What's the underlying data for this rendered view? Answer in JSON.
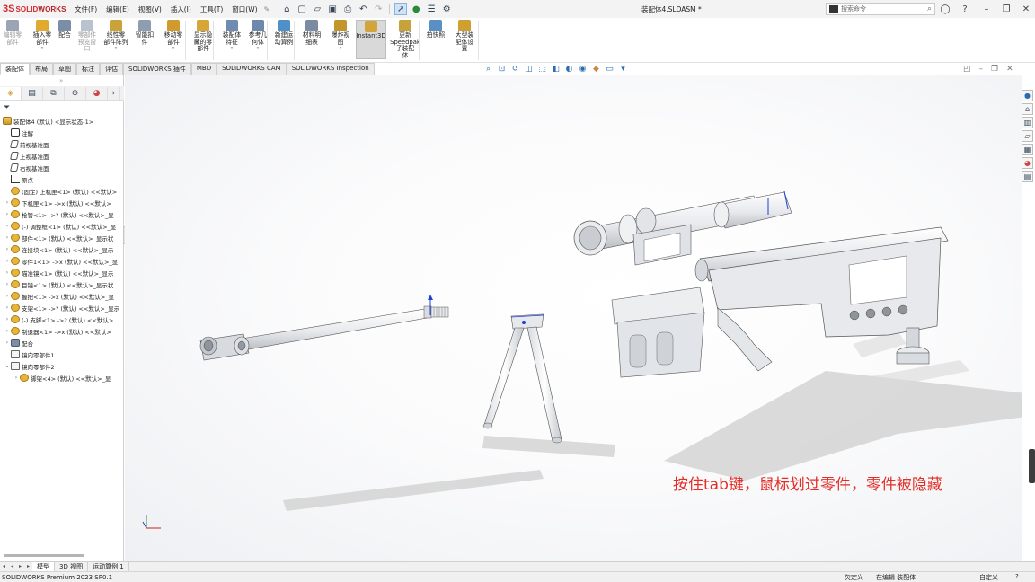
{
  "app": {
    "logo_mark": "3S",
    "logo_word_a": "SOLID",
    "logo_word_b": "WORKS",
    "document_title": "装配体4.SLDASM *",
    "search_placeholder": "搜索命令"
  },
  "menu": [
    "文件(F)",
    "编辑(E)",
    "视图(V)",
    "插入(I)",
    "工具(T)",
    "窗口(W)"
  ],
  "ribbon": {
    "buttons": [
      {
        "label": "编辑零\n部件",
        "disabled": true,
        "color": "#9aa4b3"
      },
      {
        "label": "插入零\n部件",
        "disabled": false,
        "dropdown": true,
        "color": "#e0a930"
      },
      {
        "label": "配合",
        "disabled": false,
        "color": "#7b8ea8"
      },
      {
        "label": "零部件\n预览窗\n口",
        "disabled": true,
        "color": "#b9c2cf"
      },
      {
        "label": "线性零\n部件阵列",
        "disabled": false,
        "dropdown": true,
        "color": "#c9a33a"
      },
      {
        "label": "智能扣\n件",
        "disabled": false,
        "color": "#8e9db1"
      },
      {
        "label": "移动零\n部件",
        "disabled": false,
        "dropdown": true,
        "color": "#d19a2e"
      },
      {
        "label": "显示隐\n藏的零\n部件",
        "disabled": false,
        "color": "#d6a736"
      },
      {
        "label": "装配体\n特征",
        "disabled": false,
        "dropdown": true,
        "color": "#6f8bb0"
      },
      {
        "label": "参考几\n何体",
        "disabled": false,
        "dropdown": true,
        "color": "#6d87ad"
      },
      {
        "label": "新建运\n动算例",
        "disabled": false,
        "color": "#4f90c8"
      },
      {
        "label": "材料明\n细表",
        "disabled": false,
        "color": "#7a8ba4"
      },
      {
        "label": "爆炸视\n图",
        "disabled": false,
        "dropdown": true,
        "color": "#c2962b"
      },
      {
        "label": "Instant3D",
        "disabled": false,
        "highlight": true,
        "color": "#d4a43c"
      },
      {
        "label": "更新\nSpeedpak\n子装配\n体",
        "disabled": false,
        "color": "#c7a13a"
      },
      {
        "label": "拍快照",
        "disabled": false,
        "color": "#5a8fc4"
      },
      {
        "label": "大型装\n配体设\n置",
        "disabled": false,
        "color": "#cf9f32"
      }
    ]
  },
  "command_tabs": [
    "装配体",
    "布局",
    "草图",
    "标注",
    "评估",
    "SOLIDWORKS 插件",
    "MBD",
    "SOLIDWORKS CAM",
    "SOLIDWORKS Inspection"
  ],
  "active_command_tab": "装配体",
  "tree": {
    "root": "装配体4 (默认) <显示状态-1>",
    "items": [
      {
        "label": "注解",
        "icon": "note",
        "expand": ""
      },
      {
        "label": "前视基准面",
        "icon": "plane",
        "expand": ""
      },
      {
        "label": "上视基准面",
        "icon": "plane",
        "expand": ""
      },
      {
        "label": "右视基准面",
        "icon": "plane",
        "expand": ""
      },
      {
        "label": "原点",
        "icon": "origin",
        "expand": ""
      },
      {
        "label": "(固定) 上机匣<1> (默认) <<默认>",
        "icon": "gear",
        "expand": ""
      },
      {
        "label": "下机匣<1> ->x (默认) <<默认>",
        "icon": "gear",
        "expand": "›"
      },
      {
        "label": "枪管<1> ->? (默认) <<默认>_显",
        "icon": "gear",
        "expand": "›"
      },
      {
        "label": "(-) 调整框<1> (默认) <<默认>_显",
        "icon": "gear",
        "expand": "›"
      },
      {
        "label": "部件<1> (默认) <<默认>_显示状",
        "icon": "gear",
        "expand": "›"
      },
      {
        "label": "连接块<1> (默认) <<默认>_显示",
        "icon": "gear",
        "expand": "›"
      },
      {
        "label": "零件1<1> ->x (默认) <<默认>_显",
        "icon": "gear",
        "expand": "›"
      },
      {
        "label": "瞄准镜<1> (默认) <<默认>_显示",
        "icon": "gear",
        "expand": "›"
      },
      {
        "label": "目镜<1> (默认) <<默认>_显示状",
        "icon": "gear",
        "expand": "›"
      },
      {
        "label": "握把<1> ->x (默认) <<默认>_显",
        "icon": "gear",
        "expand": "›"
      },
      {
        "label": "支架<1> ->? (默认) <<默认>_显示",
        "icon": "gear",
        "expand": "›"
      },
      {
        "label": "(-) 支脚<1> ->? (默认) <<默认>",
        "icon": "gear",
        "expand": "›"
      },
      {
        "label": "制退器<1> ->x (默认) <<默认>",
        "icon": "gear",
        "expand": "›"
      },
      {
        "label": "配合",
        "icon": "mate",
        "expand": "›"
      },
      {
        "label": "镜向零部件1",
        "icon": "fold",
        "expand": ""
      },
      {
        "label": "镜向零部件2",
        "icon": "fold",
        "expand": "⌄"
      },
      {
        "label": "脚架<4> (默认) <<默认>_显",
        "icon": "gear",
        "expand": "›",
        "indent": true
      }
    ]
  },
  "viewport": {
    "annotation": "按住tab键，鼠标划过零件，零件被隐藏"
  },
  "bottom_tabs": [
    "模型",
    "3D 视图",
    "运动算例 1"
  ],
  "status": {
    "version": "SOLIDWORKS Premium 2023 SP0.1",
    "underdefined": "欠定义",
    "editing": "在编辑 装配体",
    "custom": "自定义"
  }
}
